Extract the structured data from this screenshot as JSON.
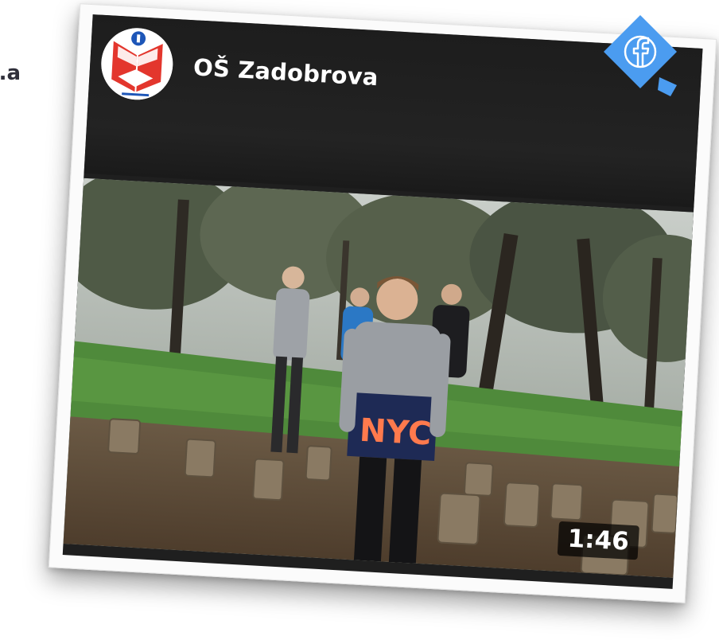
{
  "page_edge_text": "a.",
  "post": {
    "page_name": "OŠ Zadobrova",
    "logo_icon": "school-logo-icon",
    "video": {
      "duration": "1:46",
      "shirt_text": "NYC"
    }
  },
  "share_badge": {
    "icon": "facebook-icon",
    "color": "#4b9cf0"
  }
}
